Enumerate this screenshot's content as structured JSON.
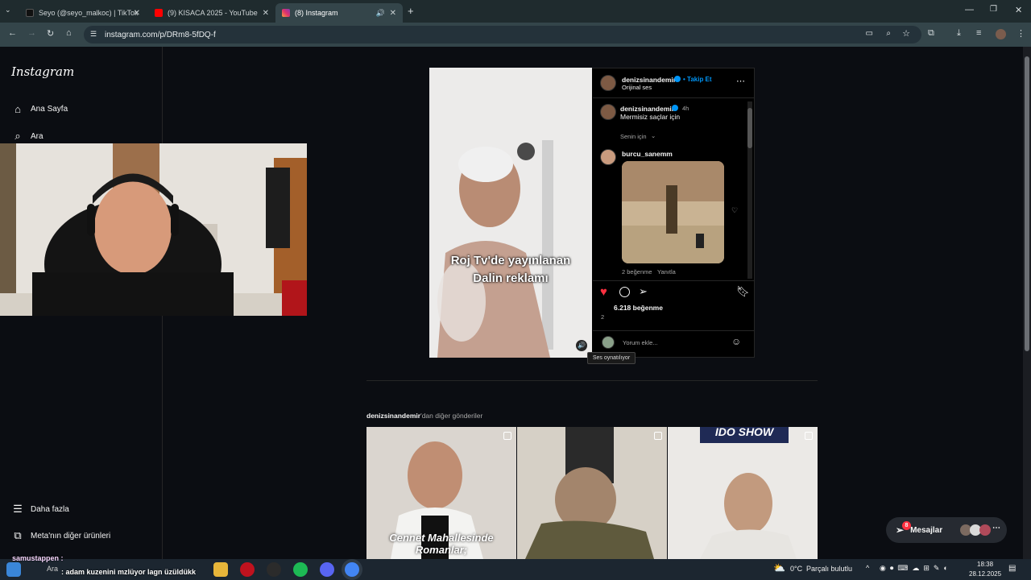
{
  "tabs": [
    {
      "title": "Seyo (@seyo_malkoc) | TikTok",
      "favicon_color": "#000000"
    },
    {
      "title": "(9) KISACA 2025 - YouTube",
      "favicon_color": "#ff0000"
    },
    {
      "title": "(8) Instagram",
      "favicon_color": "#e1306c"
    }
  ],
  "url": "instagram.com/p/DRm8-5fDQ-f",
  "sidebar": {
    "logo": "Instagram",
    "items": [
      {
        "label": "Ana Sayfa",
        "icon": "home-icon"
      },
      {
        "label": "Ara",
        "icon": "search-icon"
      },
      {
        "label": "Daha fazla",
        "icon": "menu-icon"
      },
      {
        "label": "Meta'nın diğer ürünleri",
        "icon": "meta-products-icon"
      }
    ]
  },
  "post": {
    "author": "denizsinandemir",
    "follow": "• Takip Et",
    "audio": "Orijinal ses",
    "video_caption_line1": "Roj Tv'de yayınlanan",
    "video_caption_line2": "Dalin reklamı",
    "caption_author": "denizsinandemir",
    "caption_time": "4h",
    "caption_text": "Mermisiz saçlar için",
    "sort_label": "Senin için",
    "comment_user": "burcu_sanemm",
    "comment_likes": "2 beğenme",
    "comment_reply": "Yanıtla",
    "likes": "6.218 beğenme",
    "likes_sub": "2",
    "add_comment_placeholder": "Yorum ekle...",
    "tooltip": "Ses oynatılıyor"
  },
  "more_posts": {
    "author": "denizsinandemir",
    "suffix": "'dan diğer gönderiler",
    "thumbs": [
      {
        "caption": "Cennet Mahallesinde Romanlar;"
      },
      {
        "caption": ""
      },
      {
        "caption": "IDO SHOW"
      }
    ]
  },
  "messages": {
    "label": "Mesajlar",
    "badge": "8"
  },
  "stream_chat": {
    "user": "samustappen :",
    "message": ": adam kuzenini mzlüyor lagn üzüldükk"
  },
  "taskbar": {
    "weather_temp": "0°C",
    "weather_desc": "Parçalı bulutlu",
    "time": "18:38",
    "date": "28.12.2025",
    "search": "Ara"
  },
  "colors": {
    "accent": "#0095f6",
    "like": "#ff3040",
    "verified": "#0095f6"
  }
}
